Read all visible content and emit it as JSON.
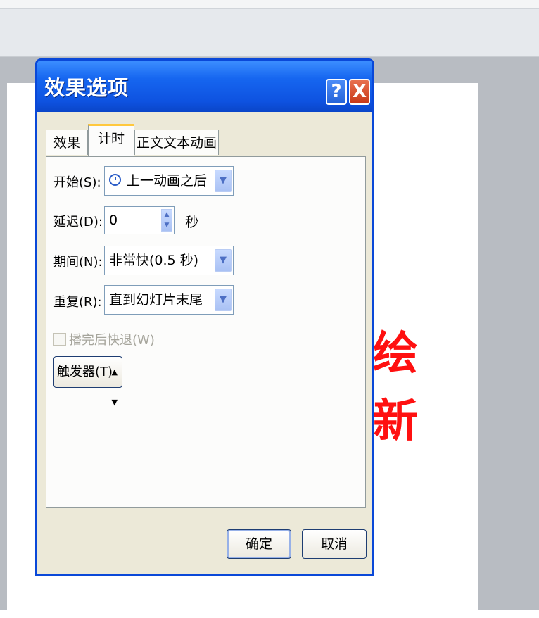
{
  "dialog": {
    "title": "效果选项",
    "help_label": "?",
    "close_label": "X",
    "tabs": [
      {
        "label": "效果",
        "active": false
      },
      {
        "label": "计时",
        "active": true
      },
      {
        "label": "正文文本动画",
        "active": false
      }
    ],
    "fields": {
      "start": {
        "label": "开始(S):",
        "value": "上一动画之后",
        "icon": "clock-icon"
      },
      "delay": {
        "label": "延迟(D):",
        "value": "0",
        "unit": "秒"
      },
      "duration": {
        "label": "期间(N):",
        "value": "非常快(0.5 秒)"
      },
      "repeat": {
        "label": "重复(R):",
        "value": "直到幻灯片末尾"
      }
    },
    "rewind_checkbox": {
      "label": "播完后快退(W)",
      "checked": false,
      "enabled": false
    },
    "trigger_button": {
      "label": "触发器(T)"
    },
    "ok_label": "确定",
    "cancel_label": "取消"
  },
  "slide": {
    "red_text": [
      "绘",
      "新"
    ]
  },
  "colors": {
    "titlebar": "#1666f0",
    "dialog_bg": "#ece9d8",
    "slide_text": "#ff1010"
  }
}
